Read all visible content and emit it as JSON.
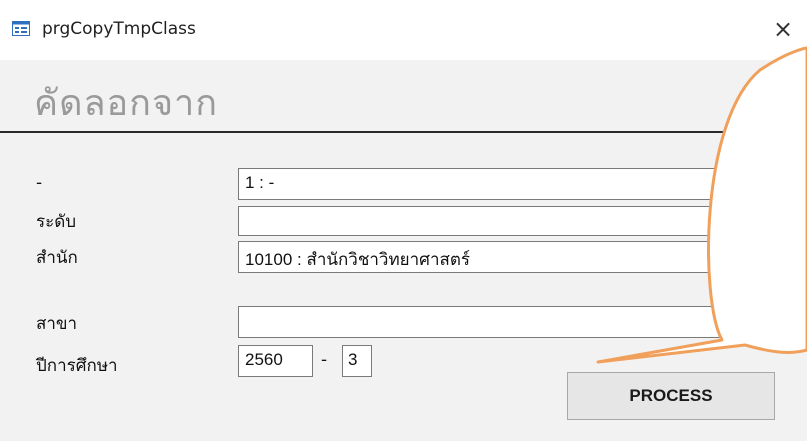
{
  "window": {
    "title": "prgCopyTmpClass",
    "close_glyph": "×",
    "icon": "form-icon"
  },
  "header": {
    "title": "คัดลอกจาก"
  },
  "form": {
    "row1": {
      "label": "-",
      "value": "1 : -"
    },
    "row2": {
      "label": "ระดับ",
      "value": ""
    },
    "row3": {
      "label": "สำนัก",
      "value": "10100 : สำนักวิชาวิทยาศาสตร์"
    },
    "row4": {
      "label": "สาขา",
      "value": ""
    },
    "row5": {
      "label": "ปีการศึกษา",
      "year": "2560",
      "separator": "-",
      "term": "3"
    },
    "dropdown_glyph": "⌄"
  },
  "actions": {
    "process_label": "PROCESS"
  },
  "colors": {
    "callout_stroke": "#f0a05a",
    "heading": "#9a9a9a"
  }
}
